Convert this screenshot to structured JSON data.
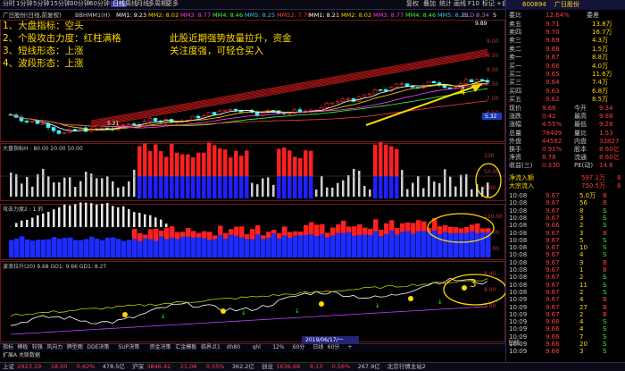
{
  "topbar": {
    "tabs": [
      "分时",
      "1分钟",
      "5分钟",
      "15分钟",
      "30分钟",
      "60分钟",
      "日线",
      "周线",
      "月线",
      "多周期",
      "更多"
    ],
    "active_tab": "日线",
    "tools": [
      "复权",
      "叠加",
      "统计",
      "画线",
      "F10",
      "标记",
      "+自选",
      "返回"
    ],
    "title": "600894 广日股份"
  },
  "stockinfo": {
    "name": "广日股份(日线,前复权)",
    "indicator_line": "BBHMM1(H)",
    "ma_values": [
      "MM1: 9.23",
      "MM2: 8.02",
      "MM3: 8.77",
      "MM4: 8.46",
      "MM5: 8.25",
      "MM52: 7.78",
      "MM1: 8.21",
      "MM2: 8.02",
      "MM3: 8.77",
      "MM4: 8.46",
      "MM5: 8.25"
    ],
    "extra": "BLD 8.34",
    "extra_value": "5"
  },
  "annotations": {
    "left_lines": [
      "1、大盘指标：空头",
      "2、个股攻击力度：红柱满格",
      "3、短线形态：上涨",
      "4、波段形态：上涨"
    ],
    "center_lines": [
      "此股近期强势放量拉升，资金",
      "关注度强，可轻仓买入"
    ],
    "label_4": "4",
    "label_2": "2",
    "label_3": "3"
  },
  "main_chart": {
    "high_label": "9.89",
    "low_label": "5.21",
    "price_box": "5.32",
    "y_labels": [
      "9.00",
      "8.50",
      "8.00",
      "7.50",
      "7.00",
      "6.50"
    ]
  },
  "panels": [
    {
      "title": "大盘指标H : 80.00 20.00 50.00",
      "y_labels": [
        "100",
        "50.00",
        "0.00"
      ]
    },
    {
      "title": "攻击力度2 : 1 的",
      "y_labels": [
        "120.00",
        "80.00",
        "40.00"
      ]
    },
    {
      "title": "波浪拉升(20)  9.68  GO1: 9.66  GD1: 8.27",
      "y_labels": [
        "8.40",
        "8.00",
        "7.60"
      ]
    }
  ],
  "bottom_tabs": [
    "指标",
    "模板",
    "较强",
    "风向力",
    "牌型图",
    "DDE决策",
    "SUP决策",
    "资金决策",
    "汇金模板",
    "临界点1",
    "dh80",
    "qhl",
    "12%",
    "60分",
    "日线",
    "60分",
    "+"
  ],
  "date_label": "2019/06/17/一",
  "bottom_label": "扩展A  关联数据",
  "right_panel": {
    "code": "600894",
    "name": "广日股份",
    "ratio_label": "委比",
    "ratio_value": "12.64%",
    "diff_label": "委差",
    "diff_value": "",
    "sell": [
      {
        "label": "卖五",
        "price": "9.71",
        "vol": "13.8万"
      },
      {
        "label": "卖四",
        "price": "9.70",
        "vol": "16.7万"
      },
      {
        "label": "卖三",
        "price": "9.69",
        "vol": "4.3万"
      },
      {
        "label": "卖二",
        "price": "9.68",
        "vol": "1.5万"
      },
      {
        "label": "卖一",
        "price": "9.67",
        "vol": "8.8万"
      }
    ],
    "buy": [
      {
        "label": "买一",
        "price": "9.66",
        "vol": "4.0万"
      },
      {
        "label": "买二",
        "price": "9.65",
        "vol": "11.6万"
      },
      {
        "label": "买三",
        "price": "9.64",
        "vol": "7.4万"
      },
      {
        "label": "买四",
        "price": "9.63",
        "vol": "6.8万"
      },
      {
        "label": "买五",
        "price": "9.62",
        "vol": "8.5万"
      }
    ],
    "stats": [
      {
        "l1": "现价",
        "v1": "9.66",
        "l2": "今开",
        "v2": "9.34"
      },
      {
        "l1": "涨跌",
        "v1": "0.42",
        "l2": "最高",
        "v2": "9.88"
      },
      {
        "l1": "涨幅",
        "v1": "4.55%",
        "l2": "最低",
        "v2": "9.28"
      },
      {
        "l1": "总量",
        "v1": "78409",
        "l2": "量比",
        "v2": "1.53"
      },
      {
        "l1": "外盘",
        "v1": "44582",
        "l2": "内盘",
        "v2": "33827"
      },
      {
        "l1": "换手",
        "v1": "0.91%",
        "l2": "股本",
        "v2": "8.60亿"
      },
      {
        "l1": "净资",
        "v1": "8.78",
        "l2": "流通",
        "v2": "8.60亿"
      },
      {
        "l1": "收益(三)",
        "v1": "0.330",
        "l2": "PE(动)",
        "v2": "14.6"
      }
    ],
    "flow": [
      {
        "label": "净流入额",
        "value": "597.1万",
        "num": "8"
      },
      {
        "label": "大宗流入",
        "value": "750.5万",
        "num": "8"
      }
    ],
    "ticks": [
      {
        "t": "10:08",
        "p": "9.67",
        "v": "5.0万",
        "d": "B"
      },
      {
        "t": "10:08",
        "p": "9.67",
        "v": "56",
        "d": "B"
      },
      {
        "t": "10:08",
        "p": "9.67",
        "v": "8",
        "d": "S"
      },
      {
        "t": "10:08",
        "p": "9.67",
        "v": "3",
        "d": "S"
      },
      {
        "t": "10:08",
        "p": "9.66",
        "v": "2",
        "d": "S"
      },
      {
        "t": "10:08",
        "p": "9.67",
        "v": "3",
        "d": "B"
      },
      {
        "t": "10:08",
        "p": "9.67",
        "v": "5",
        "d": "S"
      },
      {
        "t": "10:08",
        "p": "9.67",
        "v": "10",
        "d": "S"
      },
      {
        "t": "10:08",
        "p": "9.67",
        "v": "4",
        "d": "S"
      },
      {
        "t": "10:08",
        "p": "9.67",
        "v": "3",
        "d": "B"
      },
      {
        "t": "10:08",
        "p": "9.67",
        "v": "1",
        "d": "B"
      },
      {
        "t": "10:08",
        "p": "9.67",
        "v": "2",
        "d": "S"
      },
      {
        "t": "10:08",
        "p": "9.67",
        "v": "11",
        "d": "S"
      },
      {
        "t": "10:08",
        "p": "9.67",
        "v": "2",
        "d": "S"
      },
      {
        "t": "10:09",
        "p": "9.67",
        "v": "4",
        "d": "B"
      },
      {
        "t": "10:09",
        "p": "9.67",
        "v": "27",
        "d": "B"
      },
      {
        "t": "10:09",
        "p": "9.67",
        "v": "2",
        "d": "B"
      },
      {
        "t": "10:09",
        "p": "9.66",
        "v": "4",
        "d": "S"
      },
      {
        "t": "10:09",
        "p": "9.66",
        "v": "4",
        "d": "S"
      },
      {
        "t": "10:09",
        "p": "9.66",
        "v": "7",
        "d": "S"
      },
      {
        "t": "10:09",
        "p": "9.66",
        "v": "20",
        "d": "S"
      },
      {
        "t": "10:09",
        "p": "9.66",
        "v": "3",
        "d": "S"
      },
      {
        "t": "10:09",
        "p": "9.66",
        "v": "6",
        "d": "S"
      },
      {
        "t": "10:09",
        "p": "9.66",
        "v": "14",
        "d": "S"
      },
      {
        "t": "10:09",
        "p": "9.66",
        "v": "10",
        "d": "S"
      },
      {
        "t": "10:09",
        "p": "9.66",
        "v": "14",
        "d": "S"
      },
      {
        "t": "10:09",
        "p": "9.66",
        "v": "19",
        "d": "S"
      },
      {
        "t": "10:09",
        "p": "9.66",
        "v": "42",
        "d": "S"
      },
      {
        "t": "10:09",
        "p": "9.67",
        "v": "7",
        "d": "B"
      }
    ],
    "tick_tabs": [
      "笔",
      "价",
      "细",
      "势",
      "联",
      "主",
      "同",
      "值",
      "筹"
    ],
    "side_tab": "日线"
  },
  "statusbar": {
    "items": [
      {
        "text": "上证",
        "color": "#c8c8c8"
      },
      {
        "text": "2923.19",
        "color": "#ff3c3c"
      },
      {
        "text": "18.00",
        "color": "#ff3c3c"
      },
      {
        "text": "0.62%",
        "color": "#ff3c3c"
      },
      {
        "text": "478.5亿",
        "color": "#c8c8c8"
      },
      {
        "text": "沪深",
        "color": "#c8c8c8"
      },
      {
        "text": "3846.42",
        "color": "#ff3c3c"
      },
      {
        "text": "21.08",
        "color": "#ff3c3c"
      },
      {
        "text": "0.55%",
        "color": "#ff3c3c"
      },
      {
        "text": "362.2亿",
        "color": "#c8c8c8"
      },
      {
        "text": "创业",
        "color": "#c8c8c8"
      },
      {
        "text": "1636.68",
        "color": "#ff3c3c"
      },
      {
        "text": "9.13",
        "color": "#ff3c3c"
      },
      {
        "text": "0.56%",
        "color": "#ff3c3c"
      },
      {
        "text": "267.9亿",
        "color": "#c8c8c8"
      },
      {
        "text": "北京行情主站2",
        "color": "#c8c8c8"
      }
    ]
  }
}
